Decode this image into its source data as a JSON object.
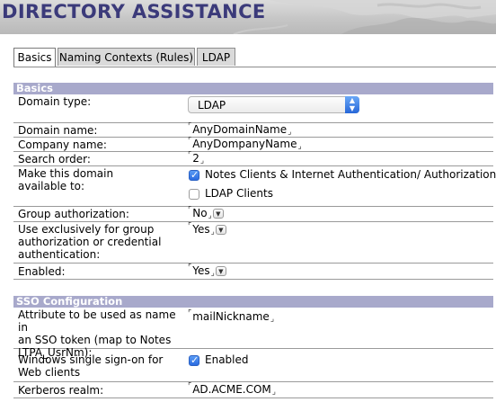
{
  "banner": {
    "title": "DIRECTORY ASSISTANCE"
  },
  "tabs": [
    {
      "label": "Basics",
      "active": true
    },
    {
      "label": "Naming Contexts (Rules)",
      "active": false
    },
    {
      "label": "LDAP",
      "active": false
    }
  ],
  "basics": {
    "header": "Basics",
    "domain_type": {
      "label": "Domain type:",
      "value": "LDAP"
    },
    "domain_name": {
      "label": "Domain name:",
      "value": "AnyDomainName"
    },
    "company_name": {
      "label": "Company name:",
      "value": "AnyDompanyName"
    },
    "search_order": {
      "label": "Search order:",
      "value": "2"
    },
    "available_to": {
      "label": "Make this domain\navailable to:",
      "options": [
        {
          "label": "Notes Clients & Internet Authentication/ Authorization",
          "checked": true
        },
        {
          "label": "LDAP Clients",
          "checked": false
        }
      ]
    },
    "group_authorization": {
      "label": "Group authorization:",
      "value": "No"
    },
    "use_exclusively": {
      "label": "Use exclusively for group\nauthorization or credential\nauthentication:",
      "value": "Yes"
    },
    "enabled": {
      "label": "Enabled:",
      "value": "Yes"
    }
  },
  "sso": {
    "header": "SSO Configuration",
    "attribute": {
      "label": "Attribute to be used as name in\nan SSO token (map to Notes\nLTPA_UsrNm):",
      "value": "mailNickname"
    },
    "windows_sso": {
      "label": "Windows single sign-on for\nWeb clients",
      "checkbox_label": "Enabled",
      "checked": true
    },
    "kerberos": {
      "label": "Kerberos realm:",
      "value": "AD.ACME.COM"
    }
  },
  "colors": {
    "section_header": "#a8a9cb",
    "title": "#3b3a7a",
    "checkbox": "#2a6be0"
  },
  "icons": {
    "dropdown": "chevron-down-icon",
    "select_arrows": "up-down-arrows-icon",
    "field_marks": "field-bracket-icon"
  }
}
